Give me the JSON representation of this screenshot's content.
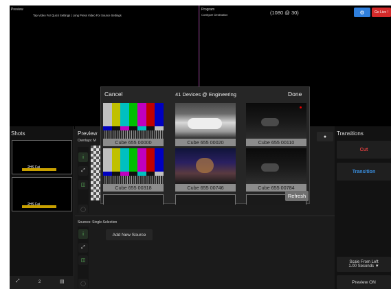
{
  "preview": {
    "title": "Preview",
    "hint": "Tap Video For Quick Settings  |  Long Press Video For Source Settings"
  },
  "program": {
    "title": "Program",
    "subtitle": "Configure Destination",
    "resolution": "(1080 @ 30)",
    "go_live_label": "Go Live !"
  },
  "shots": {
    "title": "Shots",
    "thumb_caption": "2HS Fai",
    "count": "2"
  },
  "preview_panel": {
    "title": "Preview",
    "overlays_label": "Overlays: M",
    "sources_label": "Sources:  Single-Selection",
    "add_source_label": "Add New Source"
  },
  "transitions": {
    "title": "Transitions",
    "cut_label": "Cut",
    "transition_label": "Transition",
    "scale_label_line1": "Scale From Left",
    "scale_label_line2": "1.00 Seconds ▼",
    "preview_on_label": "Preview ON"
  },
  "colors": {
    "cut_red": "#e04040",
    "transition_blue": "#3a8fe0",
    "settings_blue": "#2f7fdc",
    "go_live_red": "#d42a2a"
  },
  "device_picker": {
    "cancel_label": "Cancel",
    "title": "41 Devices @ Engineering",
    "done_label": "Done",
    "refresh_label": "Refresh",
    "devices": [
      {
        "name": "Cube 655 00000",
        "kind": "color-bars"
      },
      {
        "name": "Cube 655 00020",
        "kind": "camera-white"
      },
      {
        "name": "Cube 655 00110",
        "kind": "dark-scene"
      },
      {
        "name": "Cube 655 00318",
        "kind": "color-bars"
      },
      {
        "name": "Cube 655 00746",
        "kind": "stage"
      },
      {
        "name": "Cube 655 00784",
        "kind": "dark-scene"
      }
    ]
  }
}
